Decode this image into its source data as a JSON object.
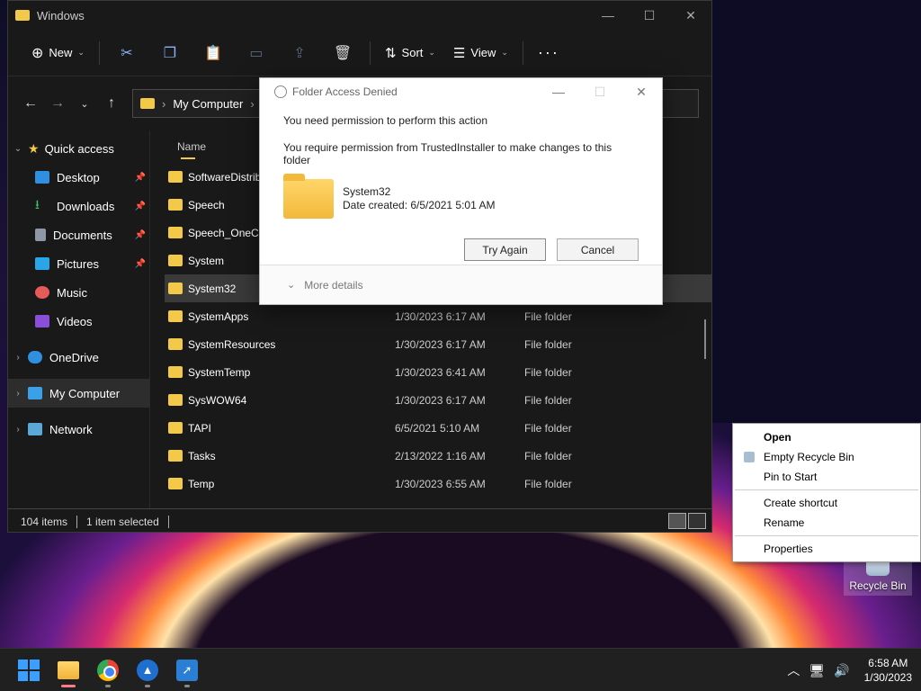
{
  "explorer": {
    "title": "Windows",
    "toolbar": {
      "new_label": "New",
      "sort_label": "Sort",
      "view_label": "View"
    },
    "address": {
      "path": "My Computer"
    },
    "nav": {
      "quick_access": "Quick access",
      "desktop": "Desktop",
      "downloads": "Downloads",
      "documents": "Documents",
      "pictures": "Pictures",
      "music": "Music",
      "videos": "Videos",
      "onedrive": "OneDrive",
      "my_computer": "My Computer",
      "network": "Network"
    },
    "column_name": "Name",
    "files": [
      {
        "name": "SoftwareDistribu",
        "date": "",
        "type": ""
      },
      {
        "name": "Speech",
        "date": "",
        "type": ""
      },
      {
        "name": "Speech_OneCor",
        "date": "",
        "type": ""
      },
      {
        "name": "System",
        "date": "",
        "type": ""
      },
      {
        "name": "System32",
        "date": "",
        "type": ""
      },
      {
        "name": "SystemApps",
        "date": "1/30/2023 6:17 AM",
        "type": "File folder"
      },
      {
        "name": "SystemResources",
        "date": "1/30/2023 6:17 AM",
        "type": "File folder"
      },
      {
        "name": "SystemTemp",
        "date": "1/30/2023 6:41 AM",
        "type": "File folder"
      },
      {
        "name": "SysWOW64",
        "date": "1/30/2023 6:17 AM",
        "type": "File folder"
      },
      {
        "name": "TAPI",
        "date": "6/5/2021 5:10 AM",
        "type": "File folder"
      },
      {
        "name": "Tasks",
        "date": "2/13/2022 1:16 AM",
        "type": "File folder"
      },
      {
        "name": "Temp",
        "date": "1/30/2023 6:55 AM",
        "type": "File folder"
      }
    ],
    "status": {
      "count": "104 items",
      "selected": "1 item selected"
    }
  },
  "dialog": {
    "title": "Folder Access Denied",
    "line1": "You need permission to perform this action",
    "line2": "You require permission from TrustedInstaller to make changes to this folder",
    "folder_name": "System32",
    "folder_created": "Date created: 6/5/2021 5:01 AM",
    "try_again": "Try Again",
    "cancel": "Cancel",
    "more_details": "More details"
  },
  "context_menu": {
    "open": "Open",
    "empty": "Empty Recycle Bin",
    "pin": "Pin to Start",
    "shortcut": "Create shortcut",
    "rename": "Rename",
    "properties": "Properties"
  },
  "desktop_icon": {
    "label": "Recycle Bin"
  },
  "taskbar": {
    "time": "6:58 AM",
    "date": "1/30/2023"
  }
}
